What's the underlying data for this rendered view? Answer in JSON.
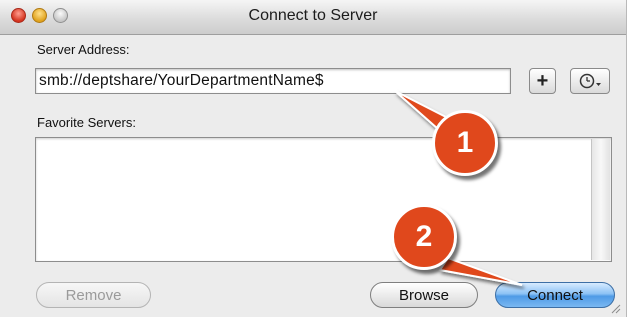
{
  "window": {
    "title": "Connect to Server"
  },
  "server_address": {
    "label": "Server Address:",
    "value": "smb://deptshare/YourDepartmentName$"
  },
  "buttons": {
    "add_favorite_icon": "plus-icon",
    "recent_servers_icon": "clock-icon",
    "remove": "Remove",
    "browse": "Browse",
    "connect": "Connect"
  },
  "favorites": {
    "label": "Favorite Servers:",
    "items": []
  },
  "callouts": {
    "step1": "1",
    "step2": "2",
    "color": "#e0481c"
  }
}
